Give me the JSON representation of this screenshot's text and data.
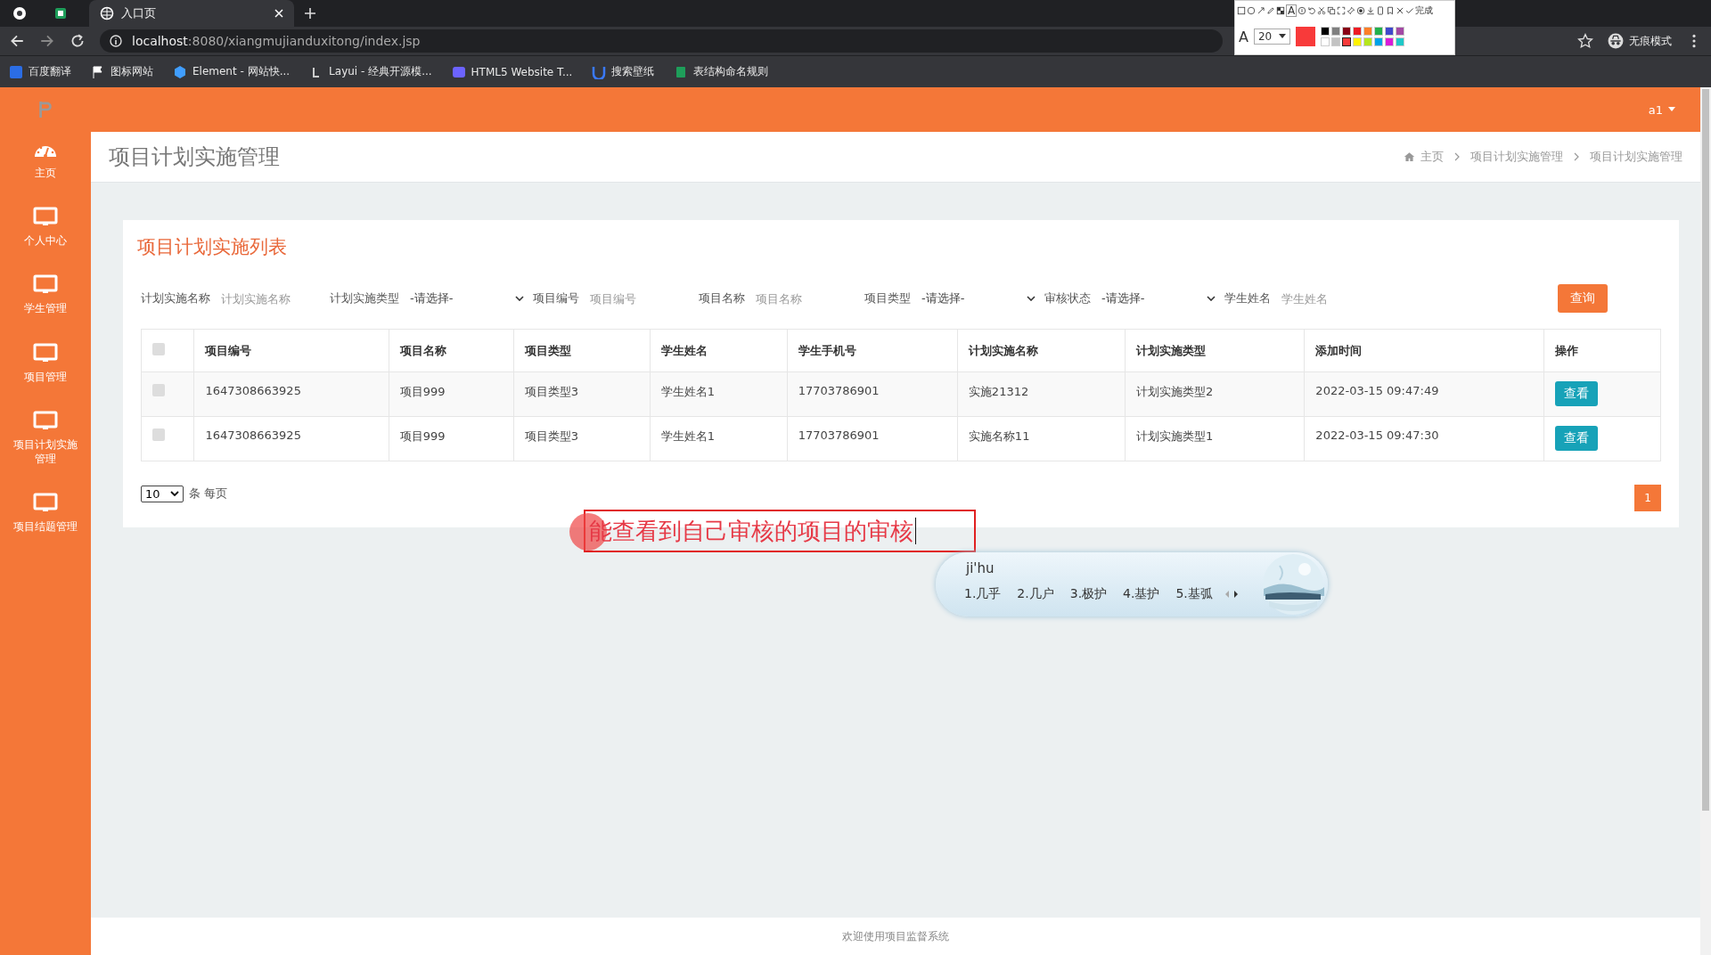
{
  "browser": {
    "tabs": [
      {
        "title": "入口页",
        "selected": true
      }
    ],
    "url_host": "localhost",
    "url_rest": ":8080/xiangmujianduxitong/index.jsp",
    "bookmarks": [
      {
        "kind": "translate",
        "label": "百度翻译"
      },
      {
        "kind": "flag",
        "label": "图标网站"
      },
      {
        "kind": "element",
        "label": "Element - 网站快..."
      },
      {
        "kind": "layui",
        "label": "Layui - 经典开源模..."
      },
      {
        "kind": "html5",
        "label": "HTML5 Website T..."
      },
      {
        "kind": "wallpaper",
        "label": "搜索壁纸"
      },
      {
        "kind": "sheet",
        "label": "表结构命名规则"
      }
    ],
    "incognito": "无痕模式"
  },
  "snip_toolbar": {
    "text_tool": "A",
    "font_label": "A",
    "font_size": "20",
    "done": "完成",
    "palette": [
      {
        "color": "#000000",
        "selected": false
      },
      {
        "color": "#7f7f7f",
        "selected": false
      },
      {
        "color": "#880015",
        "selected": false
      },
      {
        "color": "#ed1c24",
        "selected": false
      },
      {
        "color": "#ff7f27",
        "selected": false
      },
      {
        "color": "#22b14c",
        "selected": false
      },
      {
        "color": "#3f48cc",
        "selected": false
      },
      {
        "color": "#a349a4",
        "selected": false
      },
      {
        "color": "#ffffff",
        "selected": false
      },
      {
        "color": "#c3c3c3",
        "selected": false
      },
      {
        "color": "#f83a3a",
        "selected": true
      },
      {
        "color": "#fff200",
        "selected": false
      },
      {
        "color": "#b5e61d",
        "selected": false
      },
      {
        "color": "#00a2e8",
        "selected": false
      },
      {
        "color": "#d81bd8",
        "selected": false
      },
      {
        "color": "#1ec8c8",
        "selected": false
      }
    ]
  },
  "app": {
    "user": "a1",
    "sidebar": [
      {
        "kind": "dashboard",
        "label": "主页"
      },
      {
        "kind": "monitor",
        "label": "个人中心"
      },
      {
        "kind": "monitor",
        "label": "学生管理"
      },
      {
        "kind": "monitor",
        "label": "项目管理"
      },
      {
        "kind": "monitor",
        "label": "项目计划实施管理"
      },
      {
        "kind": "monitor",
        "label": "项目结题管理"
      }
    ],
    "page_title": "项目计划实施管理",
    "breadcrumbs": [
      "主页",
      "项目计划实施管理",
      "项目计划实施管理"
    ],
    "card_title": "项目计划实施列表",
    "filters": [
      {
        "kind": "input",
        "label": "计划实施名称",
        "placeholder": "计划实施名称"
      },
      {
        "kind": "select",
        "label": "计划实施类型",
        "value": "-请选择-"
      },
      {
        "kind": "input",
        "label": "项目编号",
        "placeholder": "项目编号"
      },
      {
        "kind": "input",
        "label": "项目名称",
        "placeholder": "项目名称"
      },
      {
        "kind": "select",
        "label": "项目类型",
        "value": "-请选择-"
      },
      {
        "kind": "select",
        "label": "审核状态",
        "value": "-请选择-"
      },
      {
        "kind": "input",
        "label": "学生姓名",
        "placeholder": "学生姓名"
      }
    ],
    "search_button": "查询",
    "table": {
      "header_checked": false,
      "columns": [
        "项目编号",
        "项目名称",
        "项目类型",
        "学生姓名",
        "学生手机号",
        "计划实施名称",
        "计划实施类型",
        "添加时间",
        "操作"
      ],
      "rows": [
        {
          "checked": false,
          "cells": [
            "1647308663925",
            "项目999",
            "项目类型3",
            "学生姓名1",
            "17703786901",
            "实施21312",
            "计划实施类型2",
            "2022-03-15 09:47:49"
          ],
          "action": "查看"
        },
        {
          "checked": false,
          "cells": [
            "1647308663925",
            "项目999",
            "项目类型3",
            "学生姓名1",
            "17703786901",
            "实施名称11",
            "计划实施类型1",
            "2022-03-15 09:47:30"
          ],
          "action": "查看"
        }
      ]
    },
    "page_size": "10",
    "page_size_suffix": "条 每页",
    "pages": [
      {
        "label": "1",
        "selected": true
      }
    ],
    "footer": "欢迎使用项目监督系统"
  },
  "annotation": {
    "text": "能查看到自己审核的项目的审核"
  },
  "ime": {
    "input": "ji'hu",
    "candidates": [
      "1.几乎",
      "2.几户",
      "3.极护",
      "4.基护",
      "5.基弧"
    ]
  }
}
